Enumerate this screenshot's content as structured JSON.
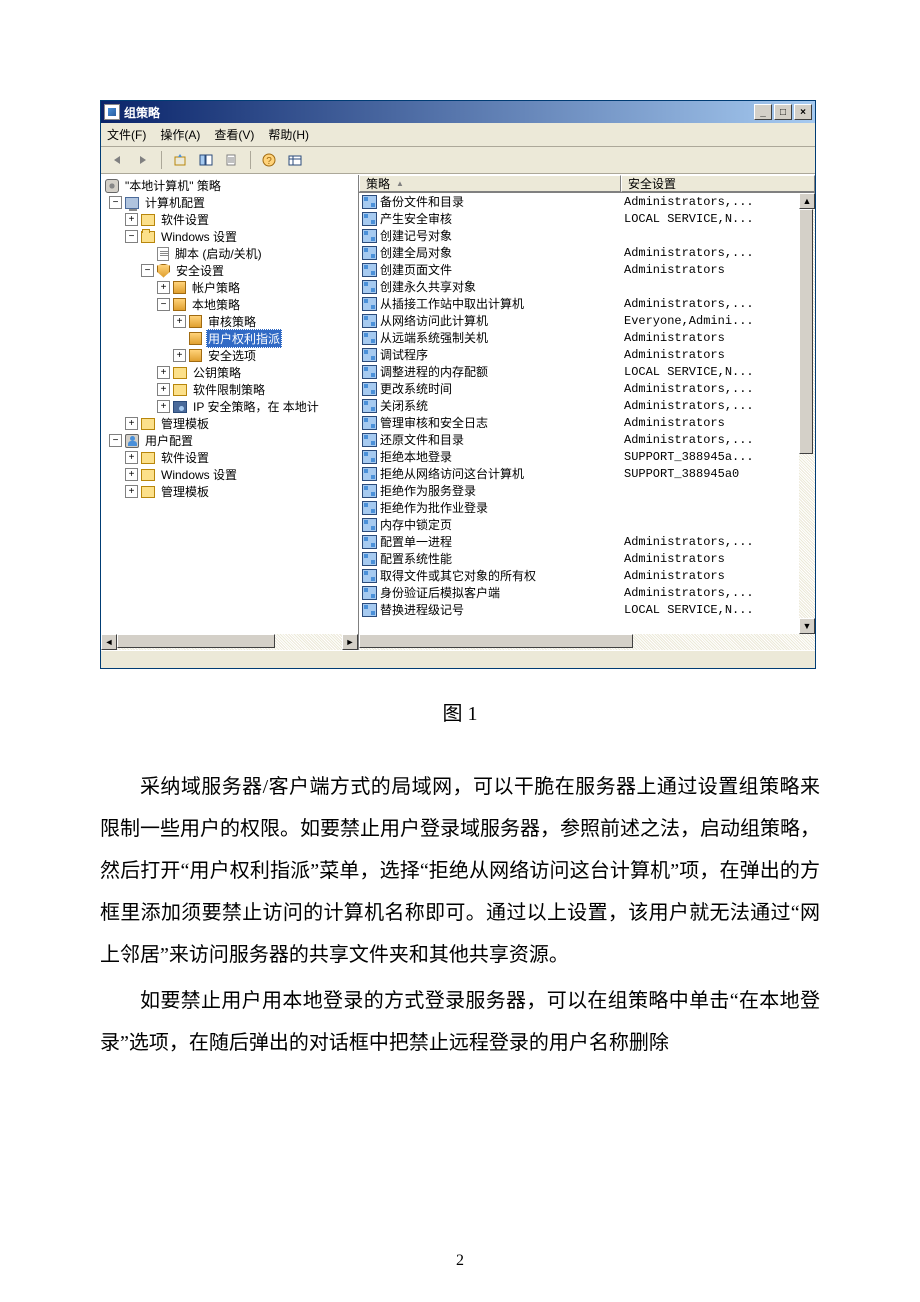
{
  "window": {
    "title": "组策略",
    "menus": {
      "file": "文件(F)",
      "action": "操作(A)",
      "view": "查看(V)",
      "help": "帮助(H)"
    },
    "winbtns": {
      "min": "_",
      "max": "□",
      "close": "×"
    }
  },
  "columns": {
    "policy": "策略",
    "security": "安全设置"
  },
  "tree": {
    "root": "\"本地计算机\" 策略",
    "computer_config": "计算机配置",
    "software": "软件设置",
    "windows": "Windows 设置",
    "scripts": "脚本 (启动/关机)",
    "security": "安全设置",
    "account": "帐户策略",
    "local": "本地策略",
    "audit": "审核策略",
    "userrights": "用户权利指派",
    "secoptions": "安全选项",
    "pubkey": "公钥策略",
    "softrestrict": "软件限制策略",
    "ipsec": "IP 安全策略，在 本地计",
    "admintpl": "管理模板",
    "user_config": "用户配置",
    "u_software": "软件设置",
    "u_windows": "Windows 设置",
    "u_admintpl": "管理模板"
  },
  "policies": [
    {
      "name": "备份文件和目录",
      "setting": "Administrators,..."
    },
    {
      "name": "产生安全审核",
      "setting": "LOCAL SERVICE,N..."
    },
    {
      "name": "创建记号对象",
      "setting": ""
    },
    {
      "name": "创建全局对象",
      "setting": "Administrators,..."
    },
    {
      "name": "创建页面文件",
      "setting": "Administrators"
    },
    {
      "name": "创建永久共享对象",
      "setting": ""
    },
    {
      "name": "从插接工作站中取出计算机",
      "setting": "Administrators,..."
    },
    {
      "name": "从网络访问此计算机",
      "setting": "Everyone,Admini..."
    },
    {
      "name": "从远端系统强制关机",
      "setting": "Administrators"
    },
    {
      "name": "调试程序",
      "setting": "Administrators"
    },
    {
      "name": "调整进程的内存配额",
      "setting": "LOCAL SERVICE,N..."
    },
    {
      "name": "更改系统时间",
      "setting": "Administrators,..."
    },
    {
      "name": "关闭系统",
      "setting": "Administrators,..."
    },
    {
      "name": "管理审核和安全日志",
      "setting": "Administrators"
    },
    {
      "name": "还原文件和目录",
      "setting": "Administrators,..."
    },
    {
      "name": "拒绝本地登录",
      "setting": "SUPPORT_388945a..."
    },
    {
      "name": "拒绝从网络访问这台计算机",
      "setting": "SUPPORT_388945a0"
    },
    {
      "name": "拒绝作为服务登录",
      "setting": ""
    },
    {
      "name": "拒绝作为批作业登录",
      "setting": ""
    },
    {
      "name": "内存中锁定页",
      "setting": ""
    },
    {
      "name": "配置单一进程",
      "setting": "Administrators,..."
    },
    {
      "name": "配置系统性能",
      "setting": "Administrators"
    },
    {
      "name": "取得文件或其它对象的所有权",
      "setting": "Administrators"
    },
    {
      "name": "身份验证后模拟客户端",
      "setting": "Administrators,..."
    },
    {
      "name": "替换进程级记号",
      "setting": "LOCAL SERVICE,N..."
    }
  ],
  "article": {
    "caption": "图 1",
    "p1": "采纳域服务器/客户端方式的局域网，可以干脆在服务器上通过设置组策略来限制一些用户的权限。如要禁止用户登录域服务器，参照前述之法，启动组策略，然后打开“用户权利指派”菜单，选择“拒绝从网络访问这台计算机”项，在弹出的方框里添加须要禁止访问的计算机名称即可。通过以上设置，该用户就无法通过“网上邻居”来访问服务器的共享文件夹和其他共享资源。",
    "p2": "如要禁止用户用本地登录的方式登录服务器，可以在组策略中单击“在本地登录”选项，在随后弹出的对话框中把禁止远程登录的用户名称删除",
    "page": "2"
  }
}
